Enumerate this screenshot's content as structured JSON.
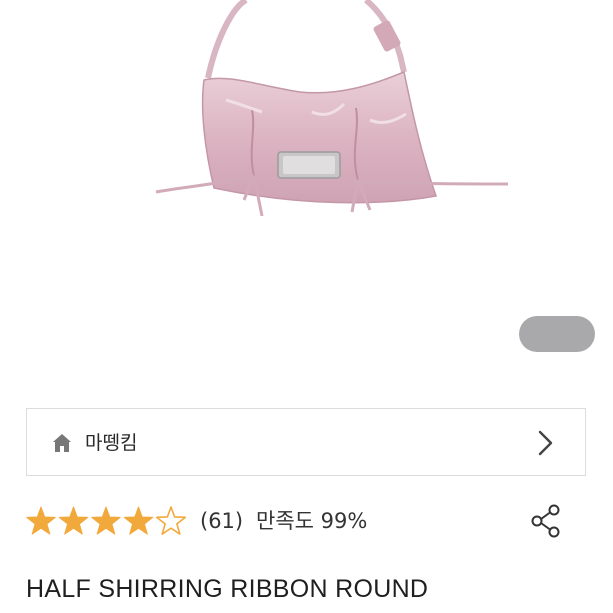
{
  "product": {
    "image_icon": "pink-shoulder-bag-image",
    "title": "HALF SHIRRING RIBBON ROUND"
  },
  "carousel": {
    "indicator_icon": "gray-pill-indicator"
  },
  "shop": {
    "icon": "home-icon",
    "name": "마뗑킴",
    "arrow_icon": "chevron-right-icon"
  },
  "rating": {
    "stars_filled": 4,
    "stars_total": 5,
    "review_count": "(61)",
    "satisfaction": "만족도 99%",
    "star_color": "#f2a93b",
    "share_icon": "share-icon"
  }
}
